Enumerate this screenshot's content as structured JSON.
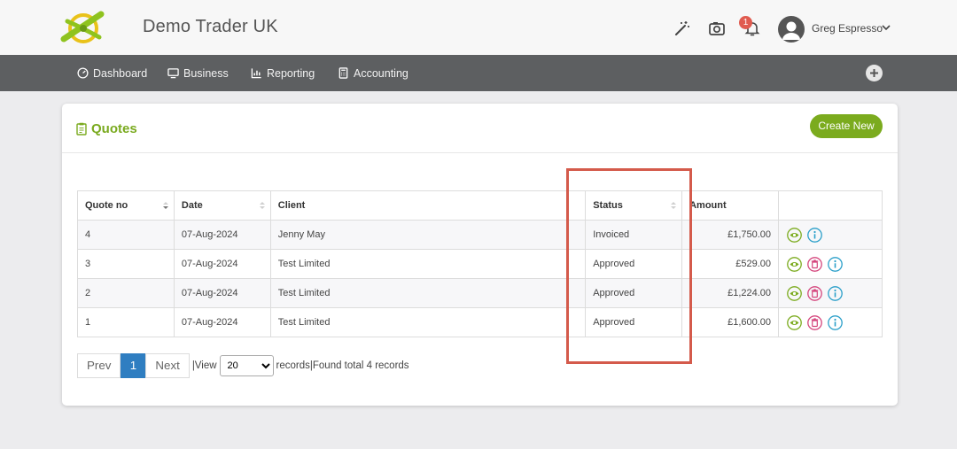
{
  "app": {
    "brand": "Demo Trader UK",
    "notification_count": "1",
    "user_name": "Greg Espresso"
  },
  "nav": {
    "items": [
      {
        "label": "Dashboard",
        "icon": "dashboard-icon"
      },
      {
        "label": "Business",
        "icon": "monitor-icon"
      },
      {
        "label": "Reporting",
        "icon": "chart-icon"
      },
      {
        "label": "Accounting",
        "icon": "calculator-icon"
      }
    ]
  },
  "quotes": {
    "title": "Quotes",
    "create_label": "Create New",
    "columns": [
      "Quote no",
      "Date",
      "Client",
      "Status",
      "Amount",
      ""
    ],
    "rows": [
      {
        "no": "4",
        "date": "07-Aug-2024",
        "client": "Jenny May",
        "status": "Invoiced",
        "amount": "£1,750.00",
        "actions": [
          "view",
          "info"
        ]
      },
      {
        "no": "3",
        "date": "07-Aug-2024",
        "client": "Test Limited",
        "status": "Approved",
        "amount": "£529.00",
        "actions": [
          "view",
          "delete",
          "info"
        ]
      },
      {
        "no": "2",
        "date": "07-Aug-2024",
        "client": "Test Limited",
        "status": "Approved",
        "amount": "£1,224.00",
        "actions": [
          "view",
          "delete",
          "info"
        ]
      },
      {
        "no": "1",
        "date": "07-Aug-2024",
        "client": "Test Limited",
        "status": "Approved",
        "amount": "£1,600.00",
        "actions": [
          "view",
          "delete",
          "info"
        ]
      }
    ]
  },
  "pager": {
    "prev": "Prev",
    "current": "1",
    "next": "Next",
    "view_label": "|View",
    "page_size": "20",
    "page_size_options": [
      "20"
    ],
    "records_label": "records",
    "found_text": "|Found total 4 records"
  },
  "colors": {
    "brand_green": "#7bab1e",
    "nav_bg": "#5d5f61",
    "highlight": "#d45a4b",
    "active_page": "#2f7ec1"
  }
}
